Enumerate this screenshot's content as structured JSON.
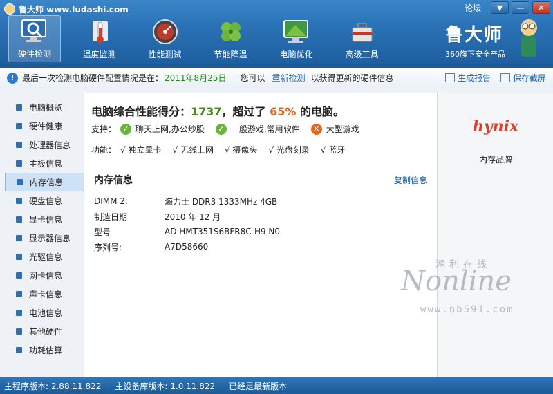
{
  "window": {
    "title": "鲁大师 www.ludashi.com",
    "forum": "论坛",
    "controls": [
      "▼",
      "—",
      "✕"
    ]
  },
  "nav": {
    "items": [
      {
        "label": "硬件检测",
        "icon": "monitor-magnifier-icon",
        "active": true
      },
      {
        "label": "温度监测",
        "icon": "thermometer-icon"
      },
      {
        "label": "性能测试",
        "icon": "speedometer-icon"
      },
      {
        "label": "节能降温",
        "icon": "clover-icon"
      },
      {
        "label": "电脑优化",
        "icon": "monitor-wrench-icon"
      },
      {
        "label": "高级工具",
        "icon": "toolbox-icon"
      }
    ]
  },
  "brand": {
    "name": "鲁大师",
    "sub": "360旗下安全产品"
  },
  "infobar": {
    "prefix": "最后一次检测电脑硬件配置情况是在：",
    "date": "2011年8月25日",
    "can": "您可以",
    "recheck": "重新检测",
    "suffix": "以获得更新的硬件信息",
    "report": "生成报告",
    "screenshot": "保存截屏"
  },
  "sidebar": {
    "items": [
      {
        "label": "电脑概览"
      },
      {
        "label": "硬件健康"
      },
      {
        "label": "处理器信息"
      },
      {
        "label": "主板信息"
      },
      {
        "label": "内存信息",
        "active": true
      },
      {
        "label": "硬盘信息"
      },
      {
        "label": "显卡信息"
      },
      {
        "label": "显示器信息"
      },
      {
        "label": "光驱信息"
      },
      {
        "label": "网卡信息"
      },
      {
        "label": "声卡信息"
      },
      {
        "label": "电池信息"
      },
      {
        "label": "其他硬件"
      },
      {
        "label": "功耗估算"
      }
    ]
  },
  "main": {
    "score_prefix": "电脑综合性能得分：",
    "score": "1737",
    "score_mid": "，超过了",
    "percent": "65%",
    "score_suffix": "的电脑。",
    "support_label": "支持：",
    "support": [
      {
        "label": "聊天上网,办公炒股",
        "ok": true
      },
      {
        "label": "一般游戏,常用软件",
        "ok": true
      },
      {
        "label": "大型游戏",
        "ok": false
      }
    ],
    "features_label": "功能：",
    "features": [
      "√ 独立显卡",
      "√ 无线上网",
      "√ 摄像头",
      "√ 光盘刻录",
      "√ 蓝牙"
    ],
    "mem_title": "内存信息",
    "copy": "复制信息",
    "rows": [
      {
        "k": "DIMM 2:",
        "v": "海力士 DDR3 1333MHz 4GB"
      },
      {
        "k": "制造日期",
        "v": "2010 年 12 月"
      },
      {
        "k": "型号",
        "v": "AD HMT351S6BFR8C-H9  N0"
      },
      {
        "k": "序列号:",
        "v": "A7D58660"
      }
    ]
  },
  "right": {
    "logo": "hynix",
    "label": "内存品牌"
  },
  "watermark": {
    "main": "Nonline",
    "sub": "鸿利在线",
    "url": "www.nb591.com"
  },
  "status": {
    "main_ver": "主程序版本: 2.88.11.822",
    "db_ver": "主设备库版本: 1.0.11.822",
    "latest": "已经是最新版本"
  },
  "colors": {
    "accent": "#2a72b6",
    "score_green": "#4a8a1a",
    "percent_orange": "#e2661b",
    "link": "#1660b8"
  }
}
